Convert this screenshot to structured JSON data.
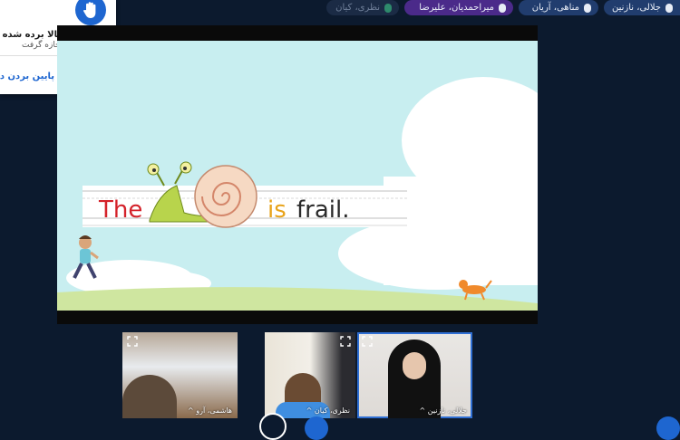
{
  "participants_bar": [
    {
      "name": "جلالی، نازنین",
      "mic": "on"
    },
    {
      "name": "مناهی، آریان",
      "mic": "on"
    },
    {
      "name": "میراحمدیان، علیرضا",
      "mic": "on",
      "highlighted": true
    },
    {
      "name": "نظری، کیان",
      "mic": "off",
      "dimmed": true
    }
  ],
  "hand_notice": {
    "title": "دست‌های بالا برده شده",
    "subtitle": "نظری، کیان اجازه گرفت",
    "lower_label": "پایین بردن دس"
  },
  "slide": {
    "sentence_parts": [
      "The",
      "is",
      "frail."
    ],
    "colors": {
      "the": "#d4222a",
      "is": "#e8a31a",
      "frail": "#2a2a2a",
      "sky": "#c8eef0",
      "grass": "#cfe6a0"
    }
  },
  "video_tiles": [
    {
      "name": "هاشمی، آرو",
      "caret": "^"
    },
    {
      "name": "نظری، کیان",
      "caret": "^"
    },
    {
      "name": "جلالی، نازنین",
      "caret": "^"
    }
  ],
  "colors": {
    "background": "#0c1a2e",
    "accent": "#1e66d0"
  }
}
